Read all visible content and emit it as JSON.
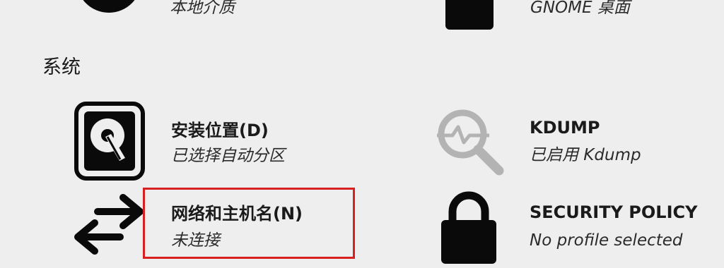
{
  "top_row": {
    "local_media": {
      "status": "本地介质",
      "icon": "disc-icon"
    },
    "software_selection": {
      "status": "GNOME 桌面",
      "icon": "package-icon"
    }
  },
  "system_section": {
    "label": "系统",
    "spokes": {
      "installation_destination": {
        "title": "安装位置(D)",
        "status": "已选择自动分区",
        "icon": "harddisk-icon"
      },
      "kdump": {
        "title": "KDUMP",
        "status": "已启用 Kdump",
        "icon": "search-icon"
      },
      "network": {
        "title": "网络和主机名(N)",
        "status": "未连接",
        "icon": "network-arrows-icon"
      },
      "security_policy": {
        "title": "SECURITY POLICY",
        "status": "No profile selected",
        "icon": "lock-icon"
      }
    }
  },
  "colors": {
    "background": "#eeeeef",
    "highlight": "#d92020",
    "icon_dark": "#0a0a0a",
    "icon_gray": "#b3b3b3"
  }
}
